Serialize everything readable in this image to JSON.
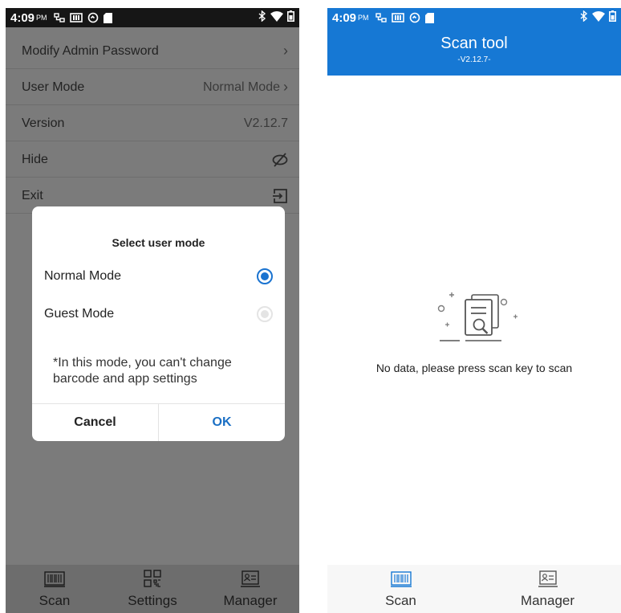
{
  "status": {
    "time": "4:09",
    "ampm": "PM"
  },
  "left": {
    "rows": [
      {
        "label": "Modify Admin Password",
        "value": ""
      },
      {
        "label": "User Mode",
        "value": "Normal Mode"
      },
      {
        "label": "Version",
        "value": "V2.12.7"
      },
      {
        "label": "Hide",
        "value": ""
      },
      {
        "label": "Exit",
        "value": ""
      }
    ],
    "dialog": {
      "title": "Select user mode",
      "options": [
        {
          "label": "Normal Mode",
          "selected": true
        },
        {
          "label": "Guest Mode",
          "selected": false
        }
      ],
      "note": "*In this mode, you can't change barcode and app settings",
      "cancel": "Cancel",
      "ok": "OK"
    },
    "nav": [
      "Scan",
      "Settings",
      "Manager"
    ]
  },
  "right": {
    "title": "Scan tool",
    "version": "-V2.12.7-",
    "empty_text": "No data, please press scan key to scan",
    "nav": [
      "Scan",
      "Manager"
    ]
  },
  "colors": {
    "accent": "#1678d4",
    "radio": "#1a73d0",
    "ok": "#1a6fc4"
  },
  "icons": [
    "network-icon",
    "sim-icon",
    "sync-icon",
    "sd-card-icon",
    "bluetooth-icon",
    "wifi-icon",
    "battery-icon",
    "eye-off-icon",
    "exit-icon",
    "barcode-icon",
    "qr-code-icon",
    "manager-card-icon",
    "empty-document-icon"
  ]
}
